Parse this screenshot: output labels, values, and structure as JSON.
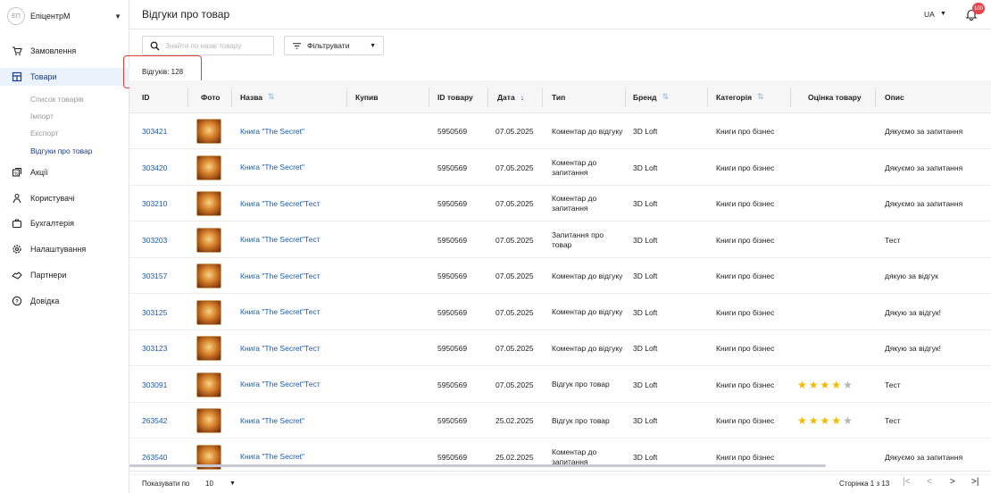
{
  "sidebar": {
    "org_avatar": "ЕП",
    "org_name": "ЕпіцентрМ",
    "items": [
      {
        "label": "Замовлення",
        "icon": "cart-icon"
      },
      {
        "label": "Товари",
        "icon": "box-icon",
        "active": true
      },
      {
        "label": "Акції",
        "icon": "promo-icon"
      },
      {
        "label": "Користувачі",
        "icon": "users-icon"
      },
      {
        "label": "Бухгалтерія",
        "icon": "briefcase-icon"
      },
      {
        "label": "Налаштування",
        "icon": "gear-icon"
      },
      {
        "label": "Партнери",
        "icon": "handshake-icon"
      },
      {
        "label": "Довідка",
        "icon": "help-icon"
      }
    ],
    "sub_items": [
      "Список товарів",
      "Імпорт",
      "Експорт",
      "Відгуки про товар"
    ]
  },
  "header": {
    "title": "Відгуки про товар",
    "lang": "UA",
    "notifications": "100"
  },
  "toolbar": {
    "search_placeholder": "Знайти по назві товару",
    "filter_label": "Фільтрувати"
  },
  "count_label": "Відгуків: 128",
  "table": {
    "headers": [
      "ID",
      "Фото",
      "Назва",
      "Купив",
      "ID товару",
      "Дата",
      "Тип",
      "Бренд",
      "Категорія",
      "Оцінка товару",
      "Опис"
    ],
    "rows": [
      {
        "id": "303421",
        "name": "Книга \"The Secret\"",
        "product_id": "5950569",
        "date": "07.05.2025",
        "type": "Коментар до відгуку",
        "brand": "3D Loft",
        "category": "Книги про бізнес",
        "rating": 0,
        "desc": "Дякуємо за запитання"
      },
      {
        "id": "303420",
        "name": "Книга \"The Secret\"",
        "product_id": "5950569",
        "date": "07.05.2025",
        "type": "Коментар до запитання",
        "brand": "3D Loft",
        "category": "Книги про бізнес",
        "rating": 0,
        "desc": "Дякуємо за запитання"
      },
      {
        "id": "303210",
        "name": "Книга \"The Secret\"Тест",
        "product_id": "5950569",
        "date": "07.05.2025",
        "type": "Коментар до запитання",
        "brand": "3D Loft",
        "category": "Книги про бізнес",
        "rating": 0,
        "desc": "Дякуємо за запитання"
      },
      {
        "id": "303203",
        "name": "Книга \"The Secret\"Тест",
        "product_id": "5950569",
        "date": "07.05.2025",
        "type": "Запитання про товар",
        "brand": "3D Loft",
        "category": "Книги про бізнес",
        "rating": 0,
        "desc": "Тест"
      },
      {
        "id": "303157",
        "name": "Книга \"The Secret\"Тест",
        "product_id": "5950569",
        "date": "07.05.2025",
        "type": "Коментар до відгуку",
        "brand": "3D Loft",
        "category": "Книги про бізнес",
        "rating": 0,
        "desc": "дякую за відгук"
      },
      {
        "id": "303125",
        "name": "Книга \"The Secret\"Тест",
        "product_id": "5950569",
        "date": "07.05.2025",
        "type": "Коментар до відгуку",
        "brand": "3D Loft",
        "category": "Книги про бізнес",
        "rating": 0,
        "desc": "Дякую за відгук!"
      },
      {
        "id": "303123",
        "name": "Книга \"The Secret\"Тест",
        "product_id": "5950569",
        "date": "07.05.2025",
        "type": "Коментар до відгуку",
        "brand": "3D Loft",
        "category": "Книги про бізнес",
        "rating": 0,
        "desc": "Дякую за відгук!"
      },
      {
        "id": "303091",
        "name": "Книга \"The Secret\"Тест",
        "product_id": "5950569",
        "date": "07.05.2025",
        "type": "Відгук про товар",
        "brand": "3D Loft",
        "category": "Книги про бізнес",
        "rating": 4,
        "desc": "Тест"
      },
      {
        "id": "263542",
        "name": "Книга \"The Secret\"",
        "product_id": "5950569",
        "date": "25.02.2025",
        "type": "Відгук про товар",
        "brand": "3D Loft",
        "category": "Книги про бізнес",
        "rating": 4,
        "desc": "Тест"
      },
      {
        "id": "263540",
        "name": "Книга \"The Secret\"",
        "product_id": "5950569",
        "date": "25.02.2025",
        "type": "Коментар до запитання",
        "brand": "3D Loft",
        "category": "Книги про бізнес",
        "rating": 0,
        "desc": "Дякуємо за запитання"
      }
    ]
  },
  "footer": {
    "per_page_label": "Показувати по",
    "per_page_value": "10",
    "page_info": "Сторінка 1 з 13"
  },
  "colors": {
    "accent": "#1a5aa8",
    "highlight": "#d9403a",
    "star": "#f5b800"
  }
}
